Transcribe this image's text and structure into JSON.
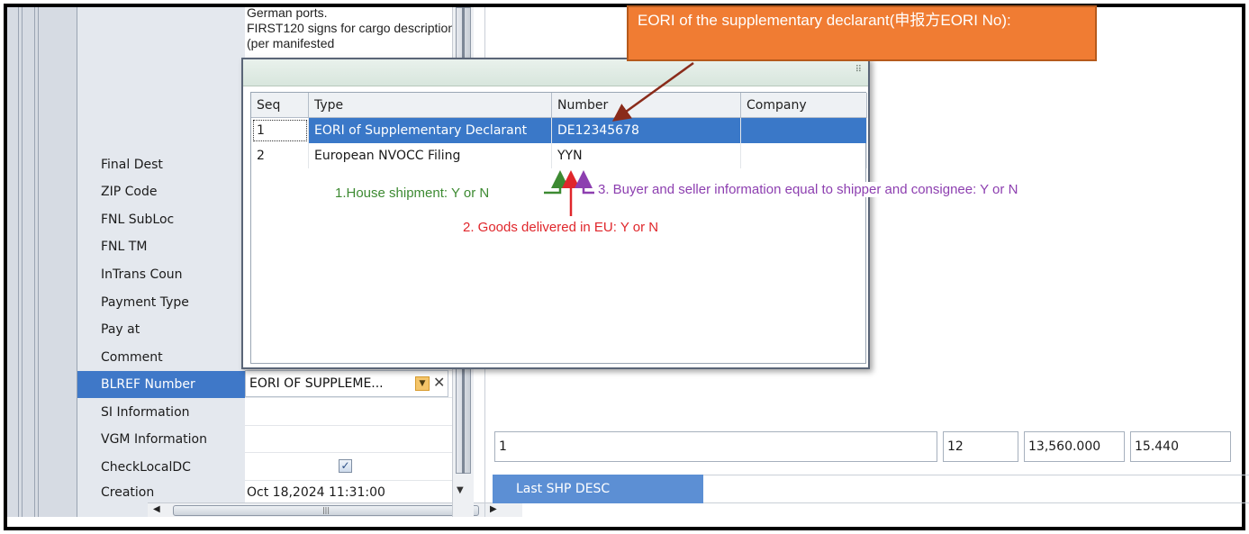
{
  "left_panel": {
    "description_text": "German ports.\nFIRST120 signs for cargo description (per manifested",
    "rows": [
      {
        "label": "Final Dest",
        "value": ""
      },
      {
        "label": "ZIP Code",
        "value": ""
      },
      {
        "label": "FNL SubLoc",
        "value": ""
      },
      {
        "label": "FNL TM",
        "value": ""
      },
      {
        "label": "InTrans Coun",
        "value": ""
      },
      {
        "label": "Payment Type",
        "value": ""
      },
      {
        "label": "Pay at",
        "value": ""
      },
      {
        "label": "Comment",
        "value": ""
      },
      {
        "label": "BLREF Number",
        "value": ""
      },
      {
        "label": "SI Information",
        "value": ""
      },
      {
        "label": "VGM Information",
        "value": ""
      },
      {
        "label": "CheckLocalDC",
        "value": ""
      },
      {
        "label": "Creation",
        "value": "Oct 18,2024 11:31:00"
      }
    ],
    "blref_combo_value": "EORI OF SUPPLEME...",
    "check_local_dc_checked": true
  },
  "popup": {
    "columns": [
      "Seq",
      "Type",
      "Number",
      "Company"
    ],
    "rows": [
      {
        "seq": "1",
        "type": "EORI of Supplementary Declarant",
        "number": "DE12345678",
        "company": ""
      },
      {
        "seq": "2",
        "type": "European NVOCC Filing",
        "number": "YYN",
        "company": ""
      }
    ]
  },
  "summary_row": {
    "cells": [
      "1",
      "12",
      "13,560.000",
      "15.440"
    ]
  },
  "last_shp_desc": "Last SHP DESC",
  "annotations": {
    "callout": "EORI of the supplementary declarant(申报方EORI No):",
    "house_shipment": "1.House shipment: Y or N",
    "goods_delivered": "2. Goods delivered in EU: Y or N",
    "buyer_seller": "3. Buyer and seller information equal to shipper and consignee: Y or N"
  },
  "icons": {
    "combo_dropdown": "chevron-down-icon",
    "combo_clear": "close-icon",
    "checkbox": "checkmark-icon",
    "popup_grip": "resize-grip-icon"
  },
  "colors": {
    "selection_blue": "#3a78c8",
    "callout_orange": "#f07c33",
    "annotation_green": "#3d8a32",
    "annotation_red": "#e0262b",
    "annotation_purple": "#8d3fb0"
  }
}
